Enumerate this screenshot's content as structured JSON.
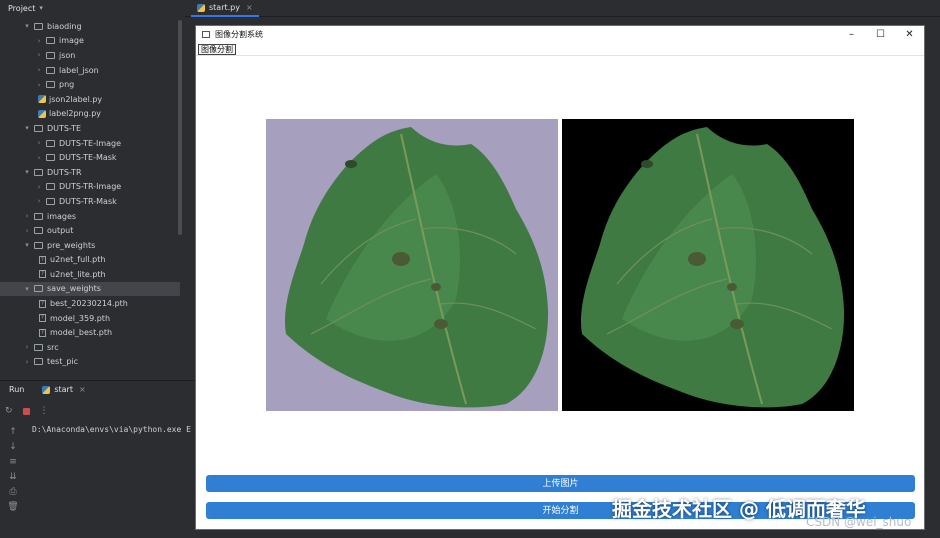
{
  "ide": {
    "project_label": "Project",
    "tree": [
      {
        "name": "biaoding",
        "type": "folder",
        "level": 1,
        "expanded": true
      },
      {
        "name": "image",
        "type": "folder",
        "level": 2,
        "expanded": false
      },
      {
        "name": "json",
        "type": "folder",
        "level": 2,
        "expanded": false
      },
      {
        "name": "label_json",
        "type": "folder",
        "level": 2,
        "expanded": false
      },
      {
        "name": "png",
        "type": "folder",
        "level": 2,
        "expanded": false
      },
      {
        "name": "json2label.py",
        "type": "py",
        "level": 2
      },
      {
        "name": "label2png.py",
        "type": "py",
        "level": 2
      },
      {
        "name": "DUTS-TE",
        "type": "folder",
        "level": 1,
        "expanded": true
      },
      {
        "name": "DUTS-TE-Image",
        "type": "folder",
        "level": 2,
        "expanded": false
      },
      {
        "name": "DUTS-TE-Mask",
        "type": "folder",
        "level": 2,
        "expanded": false
      },
      {
        "name": "DUTS-TR",
        "type": "folder",
        "level": 1,
        "expanded": true
      },
      {
        "name": "DUTS-TR-Image",
        "type": "folder",
        "level": 2,
        "expanded": false
      },
      {
        "name": "DUTS-TR-Mask",
        "type": "folder",
        "level": 2,
        "expanded": false
      },
      {
        "name": "images",
        "type": "folder",
        "level": 1,
        "expanded": false
      },
      {
        "name": "output",
        "type": "folder",
        "level": 1,
        "expanded": false
      },
      {
        "name": "pre_weights",
        "type": "folder",
        "level": 1,
        "expanded": true
      },
      {
        "name": "u2net_full.pth",
        "type": "file",
        "level": 2
      },
      {
        "name": "u2net_lite.pth",
        "type": "file",
        "level": 2
      },
      {
        "name": "save_weights",
        "type": "folder",
        "level": 1,
        "expanded": true,
        "selected": true
      },
      {
        "name": "best_20230214.pth",
        "type": "file",
        "level": 2
      },
      {
        "name": "model_359.pth",
        "type": "file",
        "level": 2
      },
      {
        "name": "model_best.pth",
        "type": "file",
        "level": 2
      },
      {
        "name": "src",
        "type": "folder",
        "level": 1,
        "expanded": false
      },
      {
        "name": "test_pic",
        "type": "folder",
        "level": 1,
        "expanded": false
      }
    ],
    "editor_tab": "start.py",
    "run_label": "Run",
    "run_tab": "start",
    "console_line": "D:\\Anaconda\\envs\\via\\python.exe E"
  },
  "app": {
    "title": "图像分割系统",
    "menu": [
      "图像分割"
    ],
    "upload_button": "上传图片",
    "segment_button": "开始分割"
  },
  "watermark": {
    "main": "掘金技术社区 @ 低调而奢华",
    "sub": "CSDN @wei_shuo"
  }
}
